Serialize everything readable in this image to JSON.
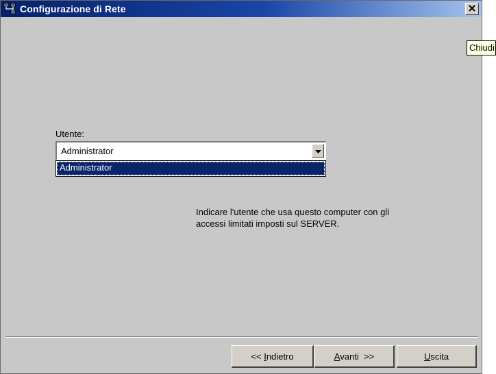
{
  "window": {
    "title": "Configurazione di Rete",
    "close_glyph": "✕",
    "tooltip": "Chiudi"
  },
  "form": {
    "user_label": "Utente:",
    "user_value": "Administrator",
    "dropdown_options": [
      "Administrator"
    ],
    "help_text_line1": "Indicare l'utente che usa questo computer con gli",
    "help_text_line2": "accessi limitati imposti sul SERVER."
  },
  "buttons": {
    "back_prefix": "<< ",
    "back_key": "I",
    "back_rest": "ndietro",
    "next_key": "A",
    "next_rest": "vanti  >>",
    "exit_key": "U",
    "exit_rest": "scita"
  },
  "colors": {
    "title_gradient_start": "#06206b",
    "title_gradient_end": "#a6c4ee",
    "selection": "#0a246a",
    "dialog_bg": "#c8c8c8",
    "tooltip_bg": "#ffffe1"
  },
  "icons": {
    "app": "network-icon",
    "close": "close-icon",
    "dropdown": "chevron-down-icon"
  }
}
